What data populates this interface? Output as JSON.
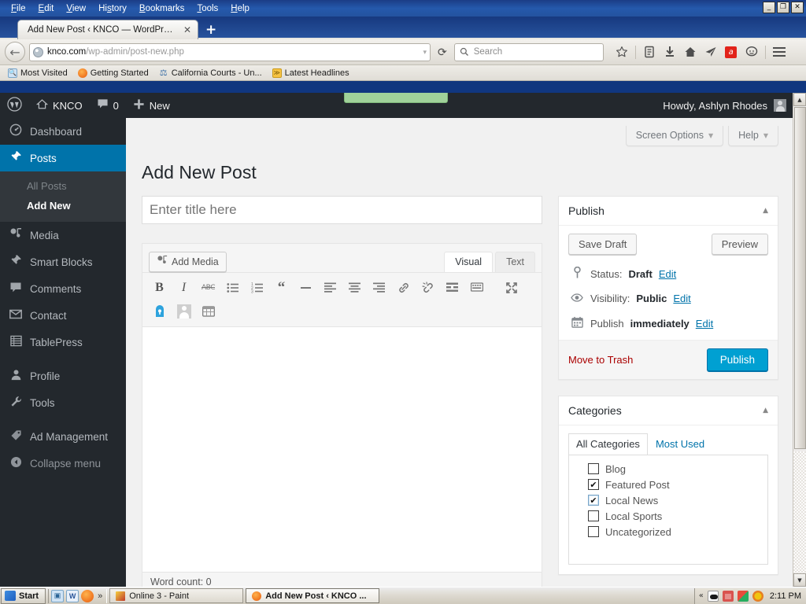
{
  "browser": {
    "menus": [
      "File",
      "Edit",
      "View",
      "History",
      "Bookmarks",
      "Tools",
      "Help"
    ],
    "window_controls": {
      "minimize": "_",
      "maximize": "❐",
      "close": "✕"
    },
    "tab": {
      "title": "Add New Post ‹ KNCO — WordPress",
      "close": "✕"
    },
    "new_tab": "+",
    "back": "←",
    "url_host": "knco.com",
    "url_path": "/wp-admin/post-new.php",
    "url_dropdown": "▾",
    "reload": "⟳",
    "search_placeholder": "Search",
    "toolbar_icons": [
      "star-icon",
      "reader-icon",
      "download-icon",
      "home-icon",
      "send-icon",
      "avira-icon",
      "chat-icon",
      "menu-icon"
    ],
    "bookmarks": [
      {
        "label": "Most Visited",
        "icon": "magnifier-icon"
      },
      {
        "label": "Getting Started",
        "icon": "firefox-icon"
      },
      {
        "label": "California Courts - Un...",
        "icon": "scales-icon"
      },
      {
        "label": "Latest Headlines",
        "icon": "rss-icon"
      }
    ]
  },
  "adminbar": {
    "wp_logo": "Ⓦ",
    "site_name": "KNCO",
    "comment_count": "0",
    "new_label": "New",
    "howdy": "Howdy, Ashlyn Rhodes"
  },
  "sidebar": {
    "items": [
      {
        "label": "Dashboard",
        "icon": "dashboard-icon",
        "current": false
      },
      {
        "label": "Posts",
        "icon": "pin-icon",
        "current": true
      },
      {
        "label": "Media",
        "icon": "media-icon",
        "current": false
      },
      {
        "label": "Smart Blocks",
        "icon": "pin-icon",
        "current": false
      },
      {
        "label": "Comments",
        "icon": "comment-icon",
        "current": false
      },
      {
        "label": "Contact",
        "icon": "envelope-icon",
        "current": false
      },
      {
        "label": "TablePress",
        "icon": "table-icon",
        "current": false
      },
      {
        "label": "Profile",
        "icon": "user-icon",
        "current": false
      },
      {
        "label": "Tools",
        "icon": "wrench-icon",
        "current": false
      },
      {
        "label": "Ad Management",
        "icon": "tag-icon",
        "current": false
      }
    ],
    "submenu": [
      {
        "label": "All Posts",
        "current": false
      },
      {
        "label": "Add New",
        "current": true
      }
    ],
    "collapse": "Collapse menu",
    "collapse_icon": "◀"
  },
  "screen_meta": {
    "screen_options": "Screen Options",
    "help": "Help",
    "caret": "▼"
  },
  "main": {
    "page_title": "Add New Post",
    "title_placeholder": "Enter title here",
    "title_value": "",
    "add_media": "Add Media",
    "add_media_icon": "media-icon",
    "editor_tabs": [
      {
        "label": "Visual",
        "active": true
      },
      {
        "label": "Text",
        "active": false
      }
    ],
    "toolbar_buttons": [
      "bold-icon",
      "italic-icon",
      "strikethrough-icon",
      "bullet-list-icon",
      "numbered-list-icon",
      "blockquote-icon",
      "horizontal-rule-icon",
      "align-left-icon",
      "align-center-icon",
      "align-right-icon",
      "insert-link-icon",
      "unlink-icon",
      "read-more-icon",
      "toolbar-toggle-icon",
      "fullscreen-icon",
      "lock-icon",
      "avatar-placeholder-icon",
      "calendar-table-icon"
    ],
    "word_count_label": "Word count: 0"
  },
  "publish_box": {
    "title": "Publish",
    "toggle": "▲",
    "save_draft": "Save Draft",
    "preview": "Preview",
    "status_label": "Status:",
    "status_value": "Draft",
    "status_icon": "pin-marker-icon",
    "visibility_label": "Visibility:",
    "visibility_value": "Public",
    "visibility_icon": "eye-icon",
    "schedule_label": "Publish",
    "schedule_value": "immediately",
    "schedule_icon": "calendar-icon",
    "edit_link": "Edit",
    "trash": "Move to Trash",
    "publish": "Publish"
  },
  "categories_box": {
    "title": "Categories",
    "toggle": "▲",
    "tabs": [
      {
        "label": "All Categories",
        "active": true
      },
      {
        "label": "Most Used",
        "active": false
      }
    ],
    "items": [
      {
        "label": "Blog",
        "checked": false
      },
      {
        "label": "Featured Post",
        "checked": true
      },
      {
        "label": "Local News",
        "checked": true
      },
      {
        "label": "Local Sports",
        "checked": false
      },
      {
        "label": "Uncategorized",
        "checked": false
      }
    ],
    "check_glyph": "✔"
  },
  "taskbar": {
    "start": "Start",
    "quick_launch": [
      "show-desktop-icon",
      "word-icon",
      "firefox-icon"
    ],
    "quick_overflow": "»",
    "tasks": [
      {
        "label": "Online 3 - Paint",
        "icon": "paint-icon",
        "active": false
      },
      {
        "label": "Add New Post ‹ KNCO ...",
        "icon": "firefox-icon",
        "active": true
      }
    ],
    "tray_chevron": "«",
    "tray_icons": [
      "cloud-icon",
      "home-icon",
      "windows-icon",
      "gear-icon"
    ],
    "clock": "2:11 PM"
  },
  "colors": {
    "wp_dark": "#23282d",
    "wp_submenu": "#32373c",
    "wp_blue": "#0073aa",
    "publish_blue": "#00a0d2",
    "trash_red": "#a00",
    "notice_green": "#a0d29a"
  }
}
